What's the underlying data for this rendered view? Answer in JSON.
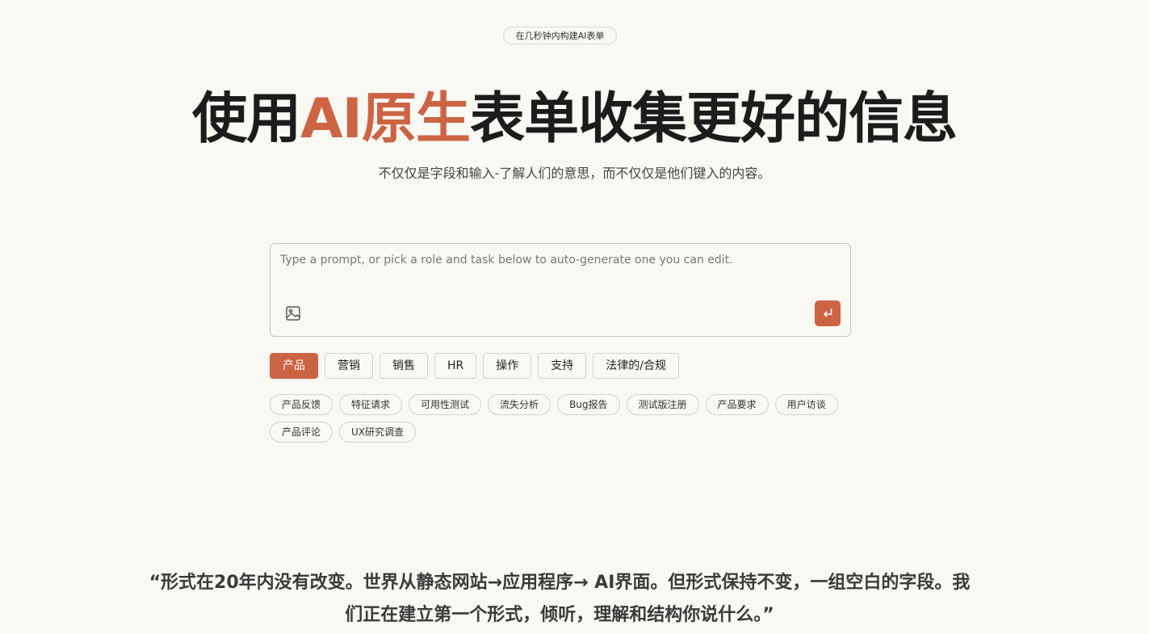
{
  "badge": "在几秒钟内构建AI表单",
  "hero": {
    "title_before": "使用",
    "title_accent": "AI原生",
    "title_after": "表单收集更好的信息",
    "subtitle": "不仅仅是字段和输入-了解人们的意思，而不仅仅是他们键入的内容。"
  },
  "prompt": {
    "placeholder": "Type a prompt, or pick a role and task below to auto-generate one you can edit.",
    "image_icon": "image-icon",
    "send_icon": "enter-arrow-icon"
  },
  "roles": [
    {
      "label": "产品",
      "active": true
    },
    {
      "label": "营销",
      "active": false
    },
    {
      "label": "销售",
      "active": false
    },
    {
      "label": "HR",
      "active": false
    },
    {
      "label": "操作",
      "active": false
    },
    {
      "label": "支持",
      "active": false
    },
    {
      "label": "法律的/合规",
      "active": false
    }
  ],
  "tasks": [
    "产品反馈",
    "特征请求",
    "可用性测试",
    "流失分析",
    "Bug报告",
    "测试版注册",
    "产品要求",
    "用户访谈",
    "产品评论",
    "UX研究调查"
  ],
  "quote": "“形式在20年内没有改变。世界从静态网站→应用程序→ AI界面。但形式保持不变，一组空白的字段。我们正在建立第一个形式，倾听，理解和结构你说什么。”",
  "colors": {
    "accent": "#cc6444",
    "background": "#faf8f3",
    "text": "#1c1c1c"
  }
}
